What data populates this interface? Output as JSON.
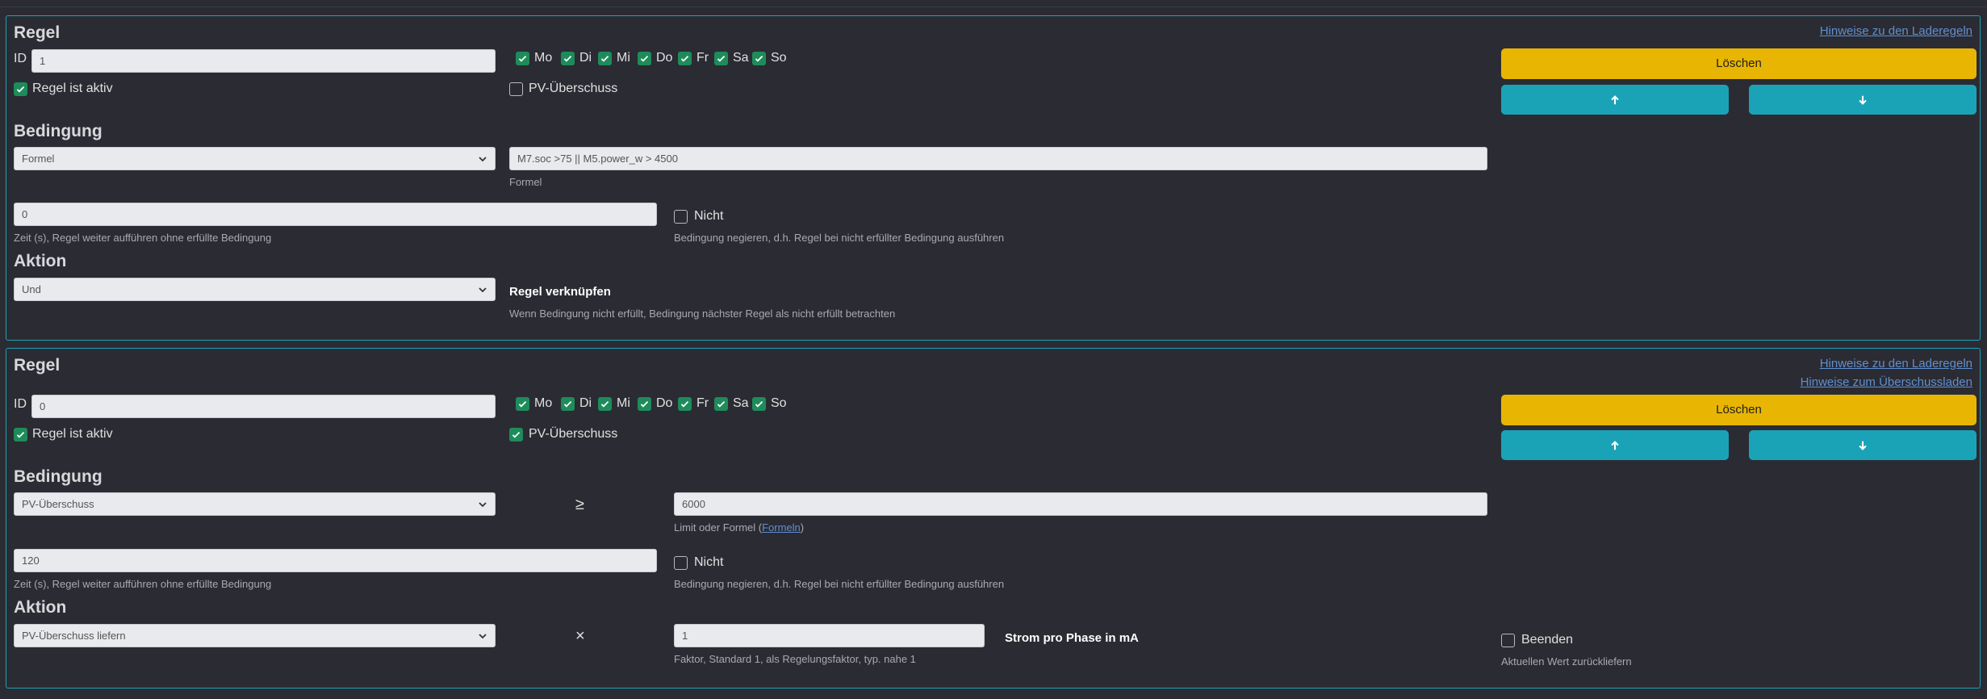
{
  "days": [
    "Mo",
    "Di",
    "Mi",
    "Do",
    "Fr",
    "Sa",
    "So"
  ],
  "common": {
    "regel_title": "Regel",
    "id_label": "ID",
    "aktiv_label": "Regel ist aktiv",
    "pv_label": "PV-Überschuss",
    "delete_label": "Löschen",
    "bedingung_title": "Bedingung",
    "aktion_title": "Aktion",
    "nicht_label": "Nicht",
    "zeit_help": "Zeit (s), Regel weiter aufführen ohne erfüllte Bedingung",
    "negate_help": "Bedingung negieren, d.h. Regel bei nicht erfüllter Bedingung ausführen",
    "link_laderegeln": "Hinweise zu den Laderegeln",
    "link_ueberschuss": "Hinweise zum Überschussladen"
  },
  "rule1": {
    "id": "1",
    "active": true,
    "pv": false,
    "condition_type": "Formel",
    "formula": "M7.soc >75 || M5.power_w > 4500",
    "formula_help": "Formel",
    "time": "0",
    "nicht": false,
    "action": "Und",
    "action_label": "Regel verknüpfen",
    "action_help": "Wenn Bedingung nicht erfüllt, Bedingung nächster Regel als nicht erfüllt betrachten"
  },
  "rule2": {
    "id": "0",
    "active": true,
    "pv": true,
    "condition_type": "PV-Überschuss",
    "operator": "≥",
    "limit": "6000",
    "limit_help_prefix": "Limit oder Formel (",
    "limit_help_link": "Formeln",
    "limit_help_suffix": ")",
    "time": "120",
    "nicht": false,
    "action": "PV-Überschuss liefern",
    "factor_operator": "×",
    "factor": "1",
    "factor_help": "Faktor, Standard 1, als Regelungsfaktor, typ. nahe 1",
    "factor_unit": "Strom pro Phase in mA",
    "beenden_label": "Beenden",
    "beenden": false,
    "beenden_help": "Aktuellen Wert zurückliefern"
  },
  "colors": {
    "accent": "#1aa3b6",
    "delete": "#e8b503",
    "check": "#1e8c5a",
    "link": "#5f8fcf"
  }
}
